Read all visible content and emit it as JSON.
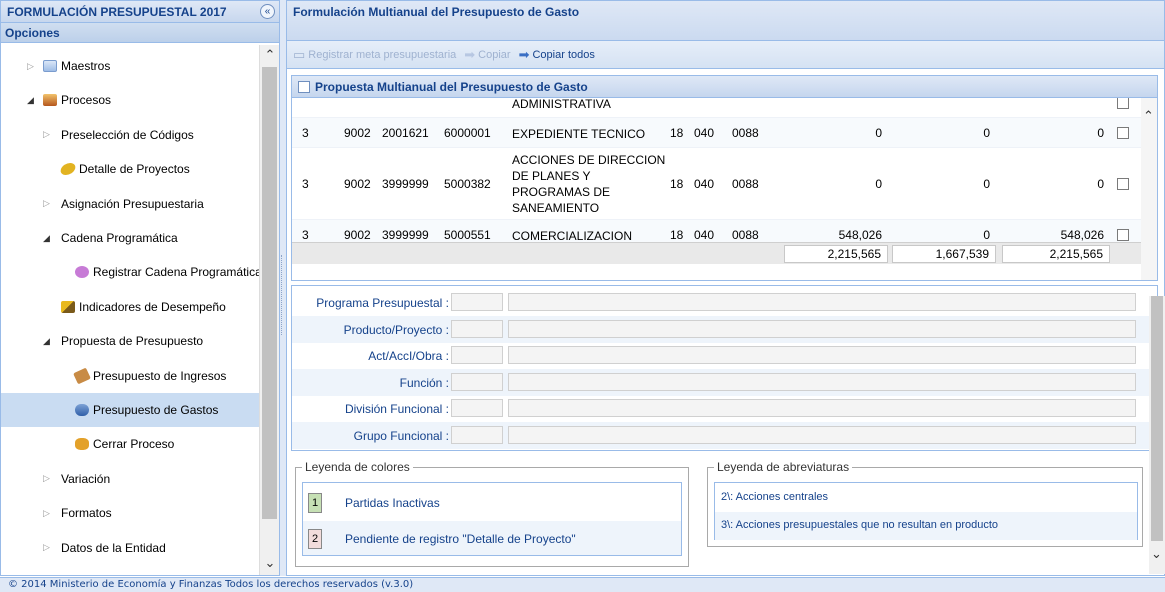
{
  "left_panel": {
    "title": "FORMULACIÓN PRESUPUESTAL 2017",
    "collapse_glyph": "«",
    "section": "Opciones",
    "tree": [
      {
        "label": "Maestros",
        "icon": "folder-icon",
        "expandable": true,
        "open": false,
        "level": 0
      },
      {
        "label": "Procesos",
        "icon": "book-icon",
        "expandable": true,
        "open": true,
        "level": 0
      },
      {
        "label": "Preselección de Códigos",
        "expandable": true,
        "open": false,
        "level": 1
      },
      {
        "label": "Detalle de Proyectos",
        "icon": "coin-icon",
        "level": 1
      },
      {
        "label": "Asignación Presupuestaria",
        "expandable": true,
        "open": false,
        "level": 1
      },
      {
        "label": "Cadena Programática",
        "expandable": true,
        "open": true,
        "level": 1
      },
      {
        "label": "Registrar Cadena Programática y",
        "icon": "users-icon",
        "level": 2
      },
      {
        "label": "Indicadores de Desempeño",
        "icon": "pencil-icon",
        "level": 1
      },
      {
        "label": "Propuesta de Presupuesto",
        "expandable": true,
        "open": true,
        "level": 1
      },
      {
        "label": "Presupuesto de Ingresos",
        "icon": "money-icon",
        "level": 2
      },
      {
        "label": "Presupuesto de Gastos",
        "icon": "coins-icon",
        "level": 2,
        "selected": true
      },
      {
        "label": "Cerrar Proceso",
        "icon": "keys-icon",
        "level": 2
      },
      {
        "label": "Variación",
        "expandable": true,
        "open": false,
        "level": 1
      },
      {
        "label": "Formatos",
        "expandable": true,
        "open": false,
        "level": 1
      },
      {
        "label": "Datos de la Entidad",
        "expandable": true,
        "open": false,
        "level": 1
      }
    ]
  },
  "right_panel": {
    "title": "Formulación Multianual del Presupuesto de Gasto",
    "toolbar": {
      "registrar": "Registrar meta presupuestaria",
      "copiar": "Copiar",
      "copiar_todos": "Copiar todos"
    },
    "grid": {
      "title": "Propuesta Multianual del Presupuesto de Gasto",
      "rows": [
        {
          "c1": "",
          "c2": "",
          "c3": "",
          "c4": "",
          "desc": [
            "ADMINISTRATIVA"
          ],
          "f": "",
          "d": "",
          "g": "",
          "v1": "",
          "v2": "",
          "v3": ""
        },
        {
          "c1": "3",
          "c2": "9002",
          "c3": "2001621",
          "c4": "6000001",
          "desc": [
            "EXPEDIENTE TECNICO"
          ],
          "f": "18",
          "d": "040",
          "g": "0088",
          "v1": "0",
          "v2": "0",
          "v3": "0"
        },
        {
          "c1": "3",
          "c2": "9002",
          "c3": "3999999",
          "c4": "5000382",
          "desc": [
            "ACCIONES DE DIRECCION",
            "DE PLANES Y",
            "PROGRAMAS DE",
            "SANEAMIENTO"
          ],
          "f": "18",
          "d": "040",
          "g": "0088",
          "v1": "0",
          "v2": "0",
          "v3": "0"
        },
        {
          "c1": "3",
          "c2": "9002",
          "c3": "3999999",
          "c4": "5000551",
          "desc": [
            "COMERCIALIZACION"
          ],
          "f": "18",
          "d": "040",
          "g": "0088",
          "v1": "548,026",
          "v2": "0",
          "v3": "548,026"
        }
      ],
      "totals": [
        "2,215,565",
        "1,667,539",
        "2,215,565"
      ]
    },
    "form": [
      "Programa Presupuestal :",
      "Producto/Proyecto :",
      "Act/AccI/Obra :",
      "Función :",
      "División Funcional :",
      "Grupo Funcional :"
    ],
    "legend_colores": {
      "title": "Leyenda de colores",
      "items": [
        {
          "num": "1",
          "label": "Partidas Inactivas",
          "color": "#c6e0b4"
        },
        {
          "num": "2",
          "label": "Pendiente de registro \"Detalle de Proyecto\"",
          "color": "#f2dcdb"
        }
      ]
    },
    "legend_abreviaturas": {
      "title": "Leyenda de abreviaturas",
      "items": [
        "2\\: Acciones centrales",
        "3\\: Acciones presupuestales que no resultan en producto"
      ]
    }
  },
  "footer": "© 2014 Ministerio de Economía y Finanzas Todos los derechos reservados (v.3.0)"
}
